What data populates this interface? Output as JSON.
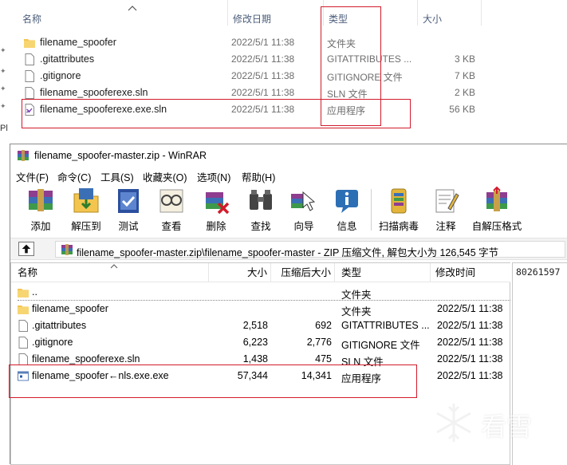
{
  "explorer": {
    "columns": {
      "name": "名称",
      "date": "修改日期",
      "type": "类型",
      "size": "大小"
    },
    "rows": [
      {
        "name": "filename_spoofer",
        "date": "2022/5/1 11:38",
        "type": "文件夹",
        "size": "",
        "icon": "folder-icon"
      },
      {
        "name": ".gitattributes",
        "date": "2022/5/1 11:38",
        "type": "GITATTRIBUTES ...",
        "size": "3 KB",
        "icon": "file-icon"
      },
      {
        "name": ".gitignore",
        "date": "2022/5/1 11:38",
        "type": "GITIGNORE 文件",
        "size": "7 KB",
        "icon": "file-icon"
      },
      {
        "name": "filename_spooferexe.sln",
        "date": "2022/5/1 11:38",
        "type": "SLN 文件",
        "size": "2 KB",
        "icon": "file-icon"
      },
      {
        "name": "filename_spooferexe.exe.sln",
        "date": "2022/5/1 11:38",
        "type": "应用程序",
        "size": "56 KB",
        "icon": "visual-studio-icon"
      }
    ],
    "left_fragment": "Pl"
  },
  "winrar": {
    "title": "filename_spoofer-master.zip - WinRAR",
    "menu": [
      "文件(F)",
      "命令(C)",
      "工具(S)",
      "收藏夹(O)",
      "选项(N)",
      "帮助(H)"
    ],
    "toolbar": [
      {
        "label": "添加",
        "icon": "add-archive-icon"
      },
      {
        "label": "解压到",
        "icon": "extract-to-icon"
      },
      {
        "label": "测试",
        "icon": "test-icon"
      },
      {
        "label": "查看",
        "icon": "view-icon"
      },
      {
        "label": "删除",
        "icon": "delete-icon"
      },
      {
        "label": "查找",
        "icon": "find-icon"
      },
      {
        "label": "向导",
        "icon": "wizard-icon"
      },
      {
        "label": "信息",
        "icon": "info-icon"
      },
      {
        "label": "扫描病毒",
        "icon": "virus-scan-icon"
      },
      {
        "label": "注释",
        "icon": "comment-icon"
      },
      {
        "label": "自解压格式",
        "icon": "sfx-icon"
      }
    ],
    "address": "filename_spoofer-master.zip\\filename_spoofer-master - ZIP 压缩文件, 解包大小为 126,545 字节",
    "columns": {
      "name": "名称",
      "size": "大小",
      "packed": "压缩后大小",
      "type": "类型",
      "modified": "修改时间"
    },
    "rows": [
      {
        "name": "..",
        "size": "",
        "packed": "",
        "type": "文件夹",
        "modified": "",
        "icon": "folder-up-icon"
      },
      {
        "name": "filename_spoofer",
        "size": "",
        "packed": "",
        "type": "文件夹",
        "modified": "2022/5/1 11:38",
        "icon": "folder-icon"
      },
      {
        "name": ".gitattributes",
        "size": "2,518",
        "packed": "692",
        "type": "GITATTRIBUTES ...",
        "modified": "2022/5/1 11:38",
        "icon": "file-icon"
      },
      {
        "name": ".gitignore",
        "size": "6,223",
        "packed": "2,776",
        "type": "GITIGNORE 文件",
        "modified": "2022/5/1 11:38",
        "icon": "file-icon"
      },
      {
        "name": "filename_spooferexe.sln",
        "size": "1,438",
        "packed": "475",
        "type": "SLN 文件",
        "modified": "2022/5/1 11:38",
        "icon": "file-icon"
      },
      {
        "name": "filename_spoofer←nls.exe.exe",
        "size": "57,344",
        "packed": "14,341",
        "type": "应用程序",
        "modified": "2022/5/1 11:38",
        "icon": "exe-icon"
      }
    ],
    "side_text": "80261597"
  },
  "watermark": "看雪",
  "colors": {
    "highlight": "#d21b2b",
    "folder": "#f3c54f",
    "header_text": "#4b5d7a"
  }
}
